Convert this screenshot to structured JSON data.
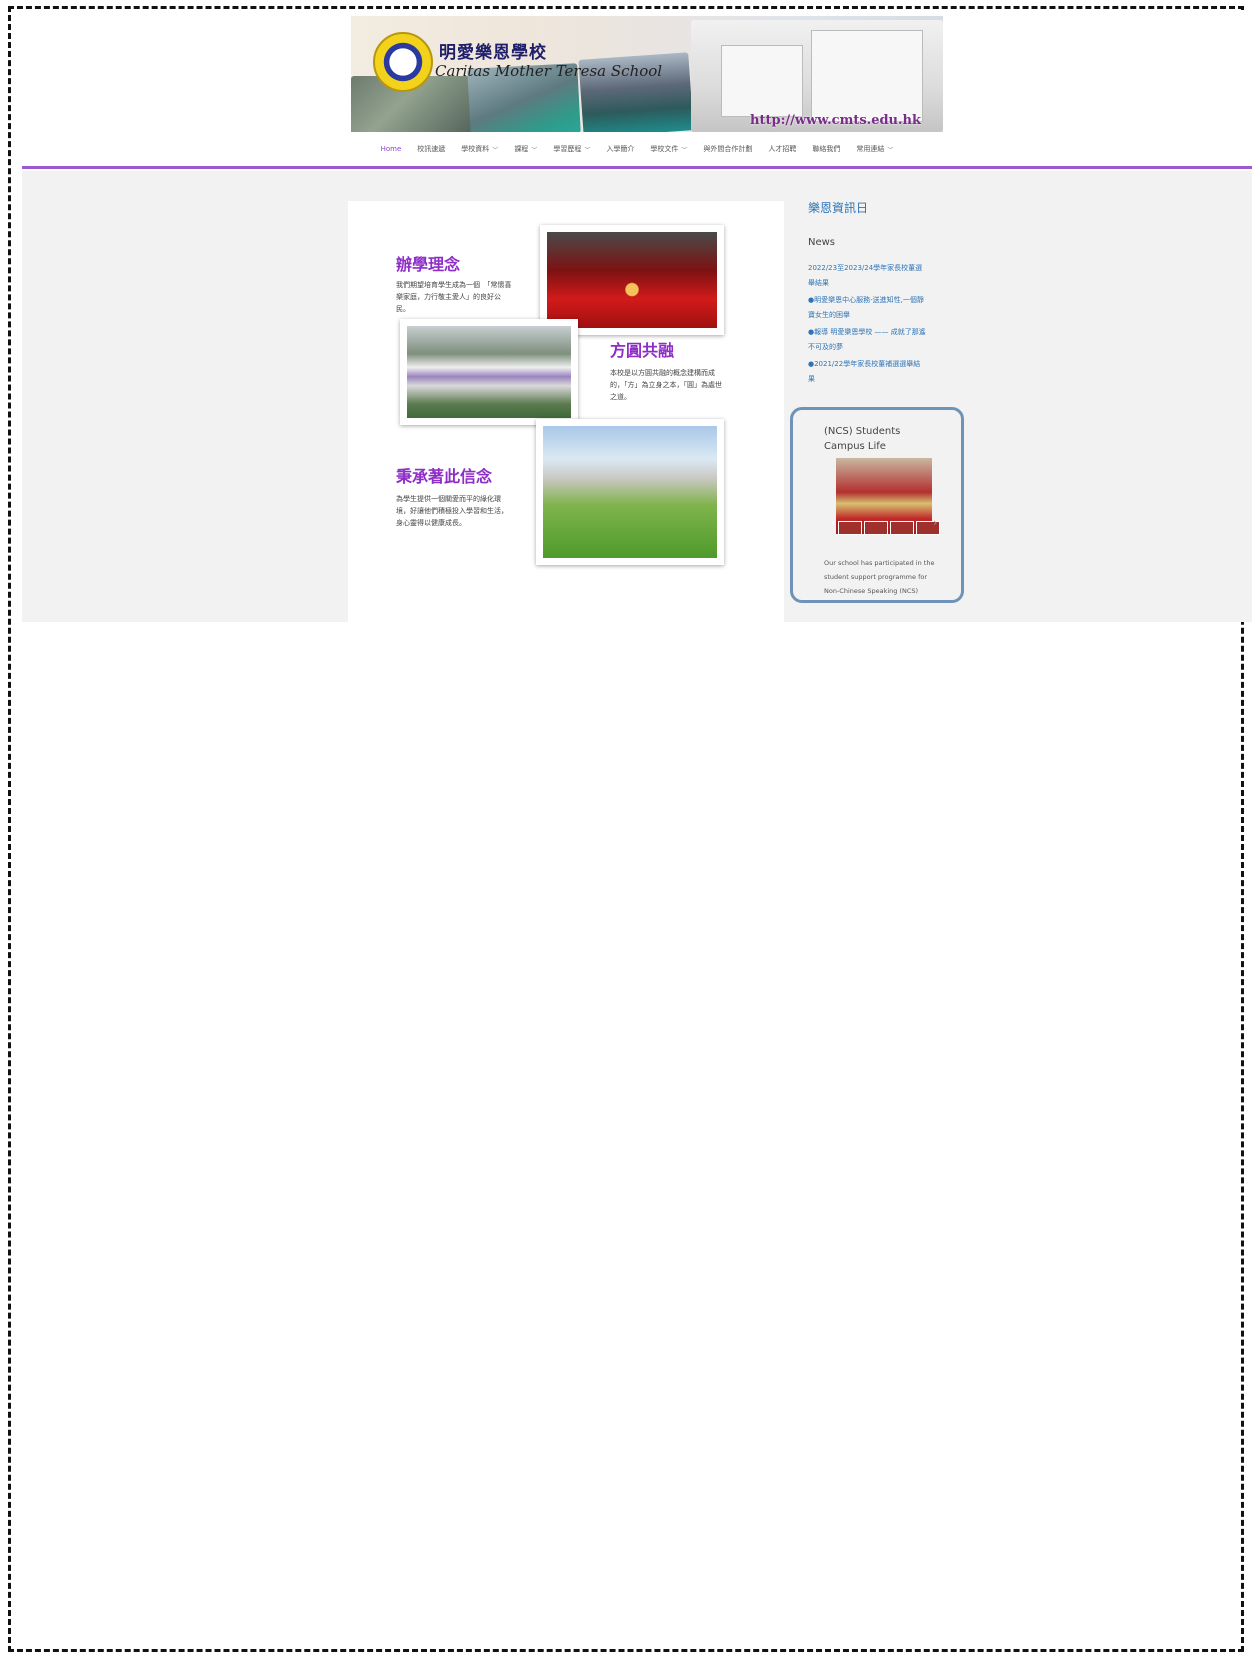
{
  "header": {
    "school_name_cn": "明愛樂恩學校",
    "school_name_en": "Caritas Mother Teresa School",
    "url_text": "http://www.cmts.edu.hk"
  },
  "nav": {
    "items": [
      {
        "label": "Home",
        "active": true,
        "has_dropdown": false
      },
      {
        "label": "校訊速遞",
        "active": false,
        "has_dropdown": false
      },
      {
        "label": "學校資料",
        "active": false,
        "has_dropdown": true
      },
      {
        "label": "課程",
        "active": false,
        "has_dropdown": true
      },
      {
        "label": "學習歷程",
        "active": false,
        "has_dropdown": true
      },
      {
        "label": "入學簡介",
        "active": false,
        "has_dropdown": false
      },
      {
        "label": "學校文件",
        "active": false,
        "has_dropdown": true
      },
      {
        "label": "與外間合作計劃",
        "active": false,
        "has_dropdown": false
      },
      {
        "label": "人才招聘",
        "active": false,
        "has_dropdown": false
      },
      {
        "label": "聯絡我們",
        "active": false,
        "has_dropdown": false
      },
      {
        "label": "常用連結",
        "active": false,
        "has_dropdown": true
      }
    ],
    "accent_color": "#9b59d0"
  },
  "article": {
    "sections": [
      {
        "title": "辦學理念",
        "text": "我們期望培育學生成為一個　「常懷喜樂家庭，力行敬主愛人」的良好公民。"
      },
      {
        "title": "方圓共融",
        "text": "本校是以方圓共融的概念建構而成的，「方」為立身之本，「圓」為處世之道。"
      },
      {
        "title": "秉承著此信念",
        "text": "為學生提供一個關愛而平的綠化環境，好讓他們積極投入學習和生活，身心靈得以健康成長。"
      }
    ],
    "title_color": "#8e2ec7"
  },
  "sidebar": {
    "title": "樂恩資訊日",
    "news_heading": "News",
    "news_items": [
      "2022/23至2023/24學年家長校董選舉結果",
      "●明愛樂恩中心服務-送進知性,一個靜寶女生的困擧",
      "●報導 明愛樂恩學校 —— 成就了那遙不可及的夢",
      "●2021/22學年家長校董補選選舉結果"
    ],
    "ncs": {
      "title": "(NCS) Students Campus Life",
      "text": "Our school has participated in the student support programme for Non-Chinese Speaking (NCS)"
    }
  }
}
